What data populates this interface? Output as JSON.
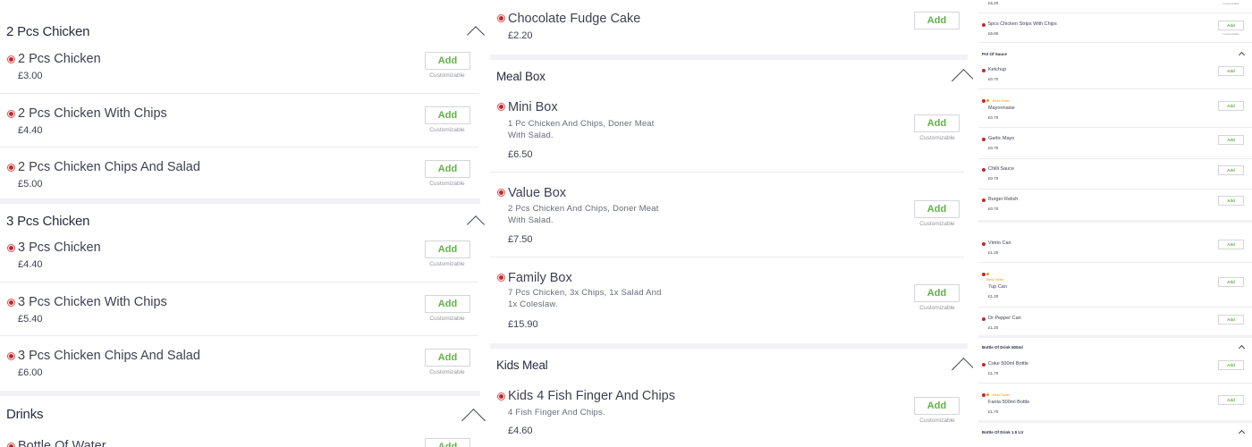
{
  "colors": {
    "accent": "#60b246",
    "veg_dot": "#c0272d",
    "bestseller": "#ee9c00"
  },
  "labels": {
    "add": "Add",
    "customizable": "Customizable",
    "bestseller": "Best Seller"
  },
  "col1": {
    "cat_2pcs": "2 Pcs Chicken",
    "cat_3pcs": "3 Pcs Chicken",
    "cat_drinks": "Drinks",
    "items": [
      {
        "name": "2 Pcs Chicken",
        "price": "£3.00"
      },
      {
        "name": "2 Pcs Chicken With Chips",
        "price": "£4.40"
      },
      {
        "name": "2 Pcs Chicken Chips And Salad",
        "price": "£5.00"
      },
      {
        "name": "3 Pcs Chicken",
        "price": "£4.40"
      },
      {
        "name": "3 Pcs Chicken With Chips",
        "price": "£5.40"
      },
      {
        "name": "3 Pcs Chicken Chips And Salad",
        "price": "£6.00"
      },
      {
        "name": "Bottle Of Water"
      }
    ]
  },
  "col2": {
    "top_item": {
      "name": "Chocolate Fudge Cake",
      "price": "£2.20"
    },
    "cat_meal_box": "Meal Box",
    "meal_box_items": [
      {
        "name": "Mini Box",
        "desc": "1 Pc Chicken And Chips, Doner Meat With Salad.",
        "price": "£6.50"
      },
      {
        "name": "Value Box",
        "desc": "2 Pcs Chicken And Chips, Doner Meat With Salad.",
        "price": "£7.50"
      },
      {
        "name": "Family Box",
        "desc": "7 Pcs Chicken, 3x Chips, 1x Salad And 1x Coleslaw.",
        "price": "£15.90"
      }
    ],
    "cat_kids_meal": "Kids Meal",
    "kids_items": [
      {
        "name": "Kids 4 Fish Finger And Chips",
        "desc": "4 Fish Finger And Chips.",
        "price": "£4.60"
      }
    ]
  },
  "col3": {
    "top_price": "£5.20",
    "strips": {
      "name": "5pcs Chicken Strips With Chips",
      "price": "£6.80"
    },
    "cat_pot_sauce": "Pot Of Sauce",
    "sauces": [
      {
        "name": "Ketchup",
        "price": "£0.70"
      },
      {
        "name": "Mayonnaise",
        "price": "£0.70"
      },
      {
        "name": "Garlic Mayo",
        "price": "£0.70"
      },
      {
        "name": "Chilli Sauce",
        "price": "£0.70"
      },
      {
        "name": "Burger Relish",
        "price": "£0.70"
      }
    ],
    "cans": [
      {
        "name": "Vimto Can",
        "price": "£1.20"
      },
      {
        "name": "7up Can",
        "price": "£1.20"
      },
      {
        "name": "Dr Pepper Can",
        "price": "£1.20"
      }
    ],
    "cat_500ml": "Bottle Of Drink 500ml",
    "bottles": [
      {
        "name": "Coke 500ml Bottle",
        "price": "£1.70"
      },
      {
        "name": "Fanta 500ml Bottle",
        "price": "£1.70"
      }
    ],
    "cat_15ltr": "Bottle Of Drink 1.5 Ltr"
  }
}
